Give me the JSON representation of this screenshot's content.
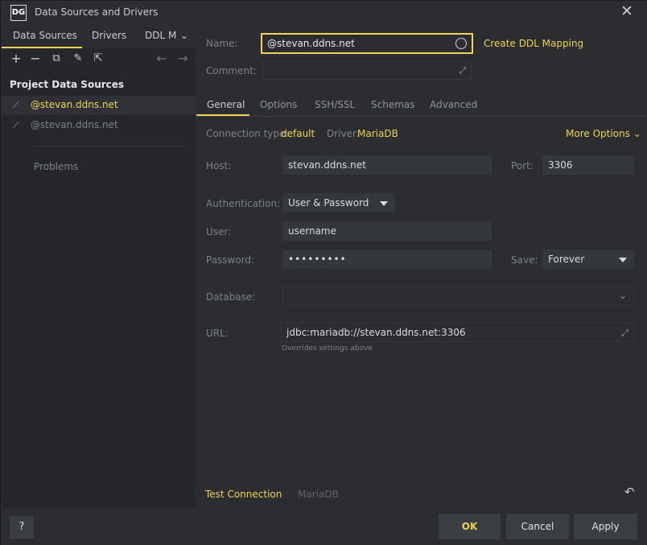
{
  "window": {
    "title": "Data Sources and Drivers",
    "logo": "DG"
  },
  "left": {
    "tabs": [
      "Data Sources",
      "Drivers",
      "DDL M"
    ],
    "section_title": "Project Data Sources",
    "items": [
      "@stevan.ddns.net",
      "@stevan.ddns.net"
    ],
    "problems": "Problems",
    "toolbar_icons": [
      "add-icon",
      "remove-icon",
      "duplicate-icon",
      "settings-icon",
      "export-icon",
      "back-icon",
      "forward-icon"
    ]
  },
  "main": {
    "name_label": "Name:",
    "name_value": "@stevan.ddns.net",
    "create_ddl": "Create DDL Mapping",
    "comment_label": "Comment:",
    "tabs": [
      "General",
      "Options",
      "SSH/SSL",
      "Schemas",
      "Advanced"
    ],
    "connection_type_label": "Connection type:",
    "connection_type_value": "default",
    "driver_label": "Driver:",
    "driver_value": "MariaDB",
    "more_options": "More Options",
    "host_label": "Host:",
    "host_value": "stevan.ddns.net",
    "port_label": "Port:",
    "port_value": "3306",
    "auth_label": "Authentication:",
    "auth_value": "User & Password",
    "user_label": "User:",
    "user_value": "username",
    "password_label": "Password:",
    "password_value": "•••••••••",
    "save_label": "Save:",
    "save_value": "Forever",
    "database_label": "Database:",
    "url_label": "URL:",
    "url_value": "jdbc:mariadb://stevan.ddns.net:3306",
    "url_hint": "Overrides settings above",
    "test_connection": "Test Connection",
    "driver_footer": "MariaDB"
  },
  "buttons": {
    "help": "?",
    "ok": "OK",
    "cancel": "Cancel",
    "apply": "Apply"
  },
  "colors": {
    "accent": "#f0d35a",
    "background": "#2b2d30",
    "panel": "#25272a",
    "field": "#34373c"
  }
}
